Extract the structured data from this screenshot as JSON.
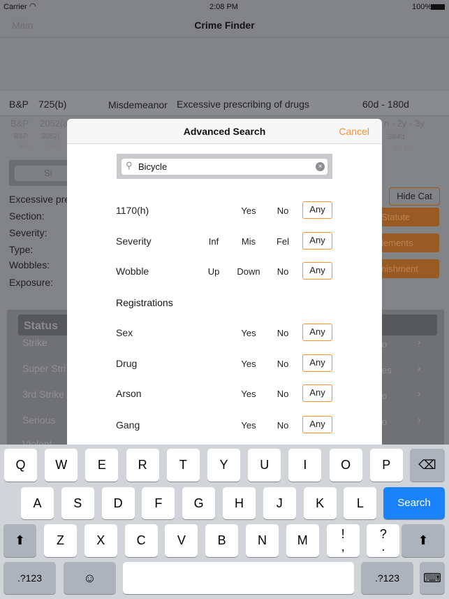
{
  "status_bar": {
    "carrier": "Carrier",
    "time": "2:08 PM",
    "battery": "100%"
  },
  "nav": {
    "back": "Main",
    "title": "Crime Finder"
  },
  "background": {
    "rows": [
      {
        "code": "B&P",
        "section": "725(b)",
        "severity": "Misdemeanor",
        "description": "Excessive prescribing of drugs",
        "punishment": "60d - 180d"
      },
      {
        "code": "B&P",
        "section": "2052(a",
        "punishment": "n - 2y - 3y"
      },
      {
        "code": "B&P",
        "section": "2052(",
        "punishment": "364d"
      },
      {
        "code": "B&P",
        "section": "2052(",
        "punishment": "2y - 3y"
      }
    ],
    "search_placeholder": "Si",
    "detail_title": "Excessive pre",
    "fields": [
      "Section:",
      "Severity:",
      "Type:",
      "Wobbles:",
      "Exposure:"
    ],
    "hide_cat": "Hide Cat",
    "side_buttons": [
      "Statute",
      "lements",
      "nishment"
    ],
    "status_header": "Status",
    "status_items": [
      {
        "label": "Strike",
        "value": "o"
      },
      {
        "label": "Super Stri",
        "value": "es"
      },
      {
        "label": "3rd Strike",
        "value": "o"
      },
      {
        "label": "Serious",
        "value": "o"
      },
      {
        "label": "Violent",
        "value": ""
      }
    ]
  },
  "modal": {
    "title": "Advanced Search",
    "cancel": "Cancel",
    "search_value": "Bicycle",
    "filters": [
      {
        "label": "1170(h)",
        "options": [
          "Yes",
          "No"
        ],
        "selected": "Any"
      },
      {
        "label": "Severity",
        "options": [
          "Inf",
          "Mis",
          "Fel"
        ],
        "selected": "Any"
      },
      {
        "label": "Wobble",
        "options": [
          "Up",
          "Down",
          "No"
        ],
        "selected": "Any"
      }
    ],
    "section_header": "Registrations",
    "registrations": [
      {
        "label": "Sex",
        "options": [
          "Yes",
          "No"
        ],
        "selected": "Any"
      },
      {
        "label": "Drug",
        "options": [
          "Yes",
          "No"
        ],
        "selected": "Any"
      },
      {
        "label": "Arson",
        "options": [
          "Yes",
          "No"
        ],
        "selected": "Any"
      },
      {
        "label": "Gang",
        "options": [
          "Yes",
          "No"
        ],
        "selected": "Any"
      }
    ]
  },
  "keyboard": {
    "row1": [
      "Q",
      "W",
      "E",
      "R",
      "T",
      "Y",
      "U",
      "I",
      "O",
      "P"
    ],
    "row2": [
      "A",
      "S",
      "D",
      "F",
      "G",
      "H",
      "J",
      "K",
      "L"
    ],
    "row3": [
      "Z",
      "X",
      "C",
      "V",
      "B",
      "N",
      "M",
      "!\n,",
      "?\n."
    ],
    "search": "Search",
    "numbers": ".?123"
  },
  "colors": {
    "accent": "#f7932c",
    "search_key": "#1a82fb"
  }
}
